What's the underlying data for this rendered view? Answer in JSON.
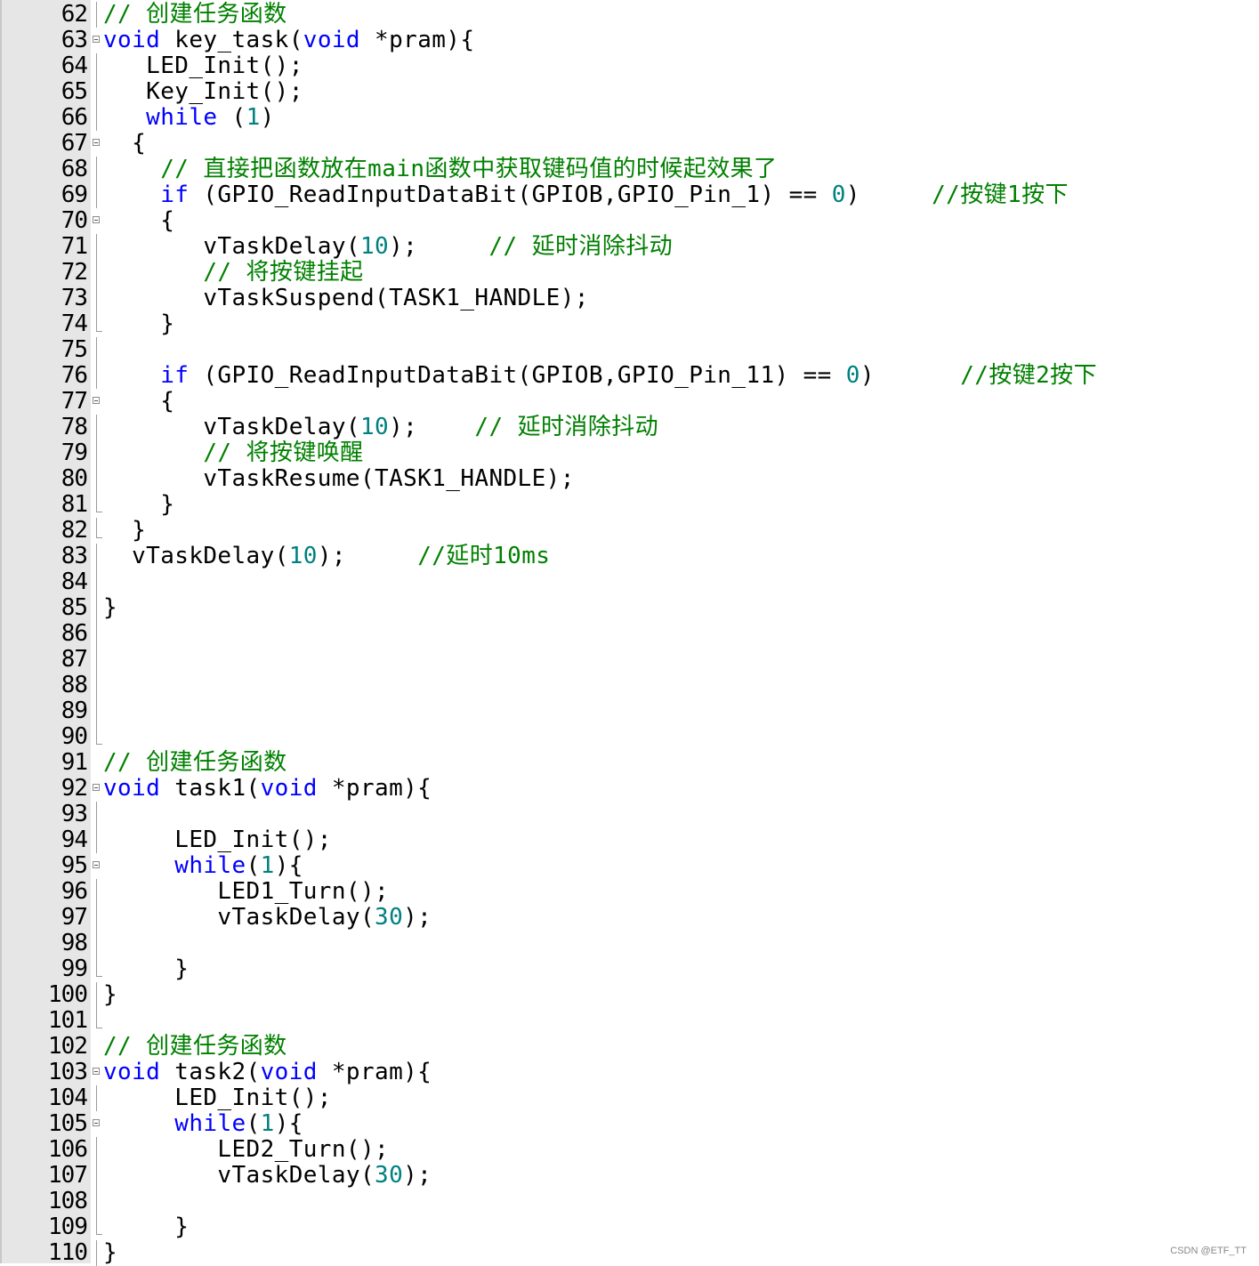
{
  "editor": {
    "lines": [
      {
        "num": "62",
        "fold": "line",
        "tokens": [
          {
            "t": "// 创建任务函数",
            "k": "comment"
          }
        ]
      },
      {
        "num": "63",
        "fold": "box",
        "tokens": [
          {
            "t": "void",
            "k": "keyword"
          },
          {
            "t": " key_task(",
            "k": "plain"
          },
          {
            "t": "void",
            "k": "keyword"
          },
          {
            "t": " *pram){",
            "k": "plain"
          }
        ]
      },
      {
        "num": "64",
        "fold": "line",
        "tokens": [
          {
            "t": "   LED_Init();",
            "k": "plain"
          }
        ]
      },
      {
        "num": "65",
        "fold": "line",
        "tokens": [
          {
            "t": "   Key_Init();",
            "k": "plain"
          }
        ]
      },
      {
        "num": "66",
        "fold": "line",
        "tokens": [
          {
            "t": "   ",
            "k": "plain"
          },
          {
            "t": "while",
            "k": "keyword"
          },
          {
            "t": " (",
            "k": "plain"
          },
          {
            "t": "1",
            "k": "number"
          },
          {
            "t": ")",
            "k": "plain"
          }
        ]
      },
      {
        "num": "67",
        "fold": "box",
        "tokens": [
          {
            "t": "  {",
            "k": "plain"
          }
        ]
      },
      {
        "num": "68",
        "fold": "line",
        "tokens": [
          {
            "t": "    ",
            "k": "plain"
          },
          {
            "t": "// 直接把函数放在main函数中获取键码值的时候起效果了",
            "k": "comment"
          }
        ]
      },
      {
        "num": "69",
        "fold": "line",
        "tokens": [
          {
            "t": "    ",
            "k": "plain"
          },
          {
            "t": "if",
            "k": "keyword"
          },
          {
            "t": " (GPIO_ReadInputDataBit(GPIOB,GPIO_Pin_1) == ",
            "k": "plain"
          },
          {
            "t": "0",
            "k": "number"
          },
          {
            "t": ")     ",
            "k": "plain"
          },
          {
            "t": "//按键1按下",
            "k": "comment"
          }
        ]
      },
      {
        "num": "70",
        "fold": "box",
        "tokens": [
          {
            "t": "    {",
            "k": "plain"
          }
        ]
      },
      {
        "num": "71",
        "fold": "line",
        "tokens": [
          {
            "t": "       vTaskDelay(",
            "k": "plain"
          },
          {
            "t": "10",
            "k": "number"
          },
          {
            "t": ");     ",
            "k": "plain"
          },
          {
            "t": "// 延时消除抖动",
            "k": "comment"
          }
        ]
      },
      {
        "num": "72",
        "fold": "line",
        "tokens": [
          {
            "t": "       ",
            "k": "plain"
          },
          {
            "t": "// 将按键挂起",
            "k": "comment"
          }
        ]
      },
      {
        "num": "73",
        "fold": "line",
        "tokens": [
          {
            "t": "       vTaskSuspend(TASK1_HANDLE);",
            "k": "plain"
          }
        ]
      },
      {
        "num": "74",
        "fold": "end",
        "tokens": [
          {
            "t": "    }",
            "k": "plain"
          }
        ]
      },
      {
        "num": "75",
        "fold": "line",
        "tokens": []
      },
      {
        "num": "76",
        "fold": "line",
        "tokens": [
          {
            "t": "    ",
            "k": "plain"
          },
          {
            "t": "if",
            "k": "keyword"
          },
          {
            "t": " (GPIO_ReadInputDataBit(GPIOB,GPIO_Pin_11) == ",
            "k": "plain"
          },
          {
            "t": "0",
            "k": "number"
          },
          {
            "t": ")      ",
            "k": "plain"
          },
          {
            "t": "//按键2按下",
            "k": "comment"
          }
        ]
      },
      {
        "num": "77",
        "fold": "box",
        "tokens": [
          {
            "t": "    {",
            "k": "plain"
          }
        ]
      },
      {
        "num": "78",
        "fold": "line",
        "tokens": [
          {
            "t": "       vTaskDelay(",
            "k": "plain"
          },
          {
            "t": "10",
            "k": "number"
          },
          {
            "t": ");    ",
            "k": "plain"
          },
          {
            "t": "// 延时消除抖动",
            "k": "comment"
          }
        ]
      },
      {
        "num": "79",
        "fold": "line",
        "tokens": [
          {
            "t": "       ",
            "k": "plain"
          },
          {
            "t": "// 将按键唤醒",
            "k": "comment"
          }
        ]
      },
      {
        "num": "80",
        "fold": "line",
        "tokens": [
          {
            "t": "       vTaskResume(TASK1_HANDLE);",
            "k": "plain"
          }
        ]
      },
      {
        "num": "81",
        "fold": "end",
        "tokens": [
          {
            "t": "    }",
            "k": "plain"
          }
        ]
      },
      {
        "num": "82",
        "fold": "end",
        "tokens": [
          {
            "t": "  }",
            "k": "plain"
          }
        ]
      },
      {
        "num": "83",
        "fold": "line",
        "tokens": [
          {
            "t": "  vTaskDelay(",
            "k": "plain"
          },
          {
            "t": "10",
            "k": "number"
          },
          {
            "t": ");     ",
            "k": "plain"
          },
          {
            "t": "//延时10ms",
            "k": "comment"
          }
        ]
      },
      {
        "num": "84",
        "fold": "line",
        "tokens": []
      },
      {
        "num": "85",
        "fold": "line",
        "tokens": [
          {
            "t": "}",
            "k": "plain"
          }
        ]
      },
      {
        "num": "86",
        "fold": "line",
        "tokens": []
      },
      {
        "num": "87",
        "fold": "line",
        "tokens": []
      },
      {
        "num": "88",
        "fold": "line",
        "tokens": []
      },
      {
        "num": "89",
        "fold": "line",
        "tokens": []
      },
      {
        "num": "90",
        "fold": "end",
        "tokens": []
      },
      {
        "num": "91",
        "fold": "none",
        "tokens": [
          {
            "t": "// 创建任务函数",
            "k": "comment"
          }
        ]
      },
      {
        "num": "92",
        "fold": "box",
        "tokens": [
          {
            "t": "void",
            "k": "keyword"
          },
          {
            "t": " task1(",
            "k": "plain"
          },
          {
            "t": "void",
            "k": "keyword"
          },
          {
            "t": " *pram){",
            "k": "plain"
          }
        ]
      },
      {
        "num": "93",
        "fold": "line",
        "tokens": []
      },
      {
        "num": "94",
        "fold": "line",
        "tokens": [
          {
            "t": "     LED_Init();",
            "k": "plain"
          }
        ]
      },
      {
        "num": "95",
        "fold": "box",
        "tokens": [
          {
            "t": "     ",
            "k": "plain"
          },
          {
            "t": "while",
            "k": "keyword"
          },
          {
            "t": "(",
            "k": "plain"
          },
          {
            "t": "1",
            "k": "number"
          },
          {
            "t": "){",
            "k": "plain"
          }
        ]
      },
      {
        "num": "96",
        "fold": "line",
        "tokens": [
          {
            "t": "        LED1_Turn();",
            "k": "plain"
          }
        ]
      },
      {
        "num": "97",
        "fold": "line",
        "tokens": [
          {
            "t": "        vTaskDelay(",
            "k": "plain"
          },
          {
            "t": "30",
            "k": "number"
          },
          {
            "t": ");",
            "k": "plain"
          }
        ]
      },
      {
        "num": "98",
        "fold": "line",
        "tokens": []
      },
      {
        "num": "99",
        "fold": "end",
        "tokens": [
          {
            "t": "     }",
            "k": "plain"
          }
        ]
      },
      {
        "num": "100",
        "fold": "line",
        "tokens": [
          {
            "t": "}",
            "k": "plain"
          }
        ]
      },
      {
        "num": "101",
        "fold": "end",
        "tokens": []
      },
      {
        "num": "102",
        "fold": "none",
        "tokens": [
          {
            "t": "// 创建任务函数",
            "k": "comment"
          }
        ]
      },
      {
        "num": "103",
        "fold": "box",
        "tokens": [
          {
            "t": "void",
            "k": "keyword"
          },
          {
            "t": " task2(",
            "k": "plain"
          },
          {
            "t": "void",
            "k": "keyword"
          },
          {
            "t": " *pram){",
            "k": "plain"
          }
        ]
      },
      {
        "num": "104",
        "fold": "line",
        "tokens": [
          {
            "t": "     LED_Init();",
            "k": "plain"
          }
        ]
      },
      {
        "num": "105",
        "fold": "box",
        "tokens": [
          {
            "t": "     ",
            "k": "plain"
          },
          {
            "t": "while",
            "k": "keyword"
          },
          {
            "t": "(",
            "k": "plain"
          },
          {
            "t": "1",
            "k": "number"
          },
          {
            "t": "){",
            "k": "plain"
          }
        ]
      },
      {
        "num": "106",
        "fold": "line",
        "tokens": [
          {
            "t": "        LED2_Turn();",
            "k": "plain"
          }
        ]
      },
      {
        "num": "107",
        "fold": "line",
        "tokens": [
          {
            "t": "        vTaskDelay(",
            "k": "plain"
          },
          {
            "t": "30",
            "k": "number"
          },
          {
            "t": ");",
            "k": "plain"
          }
        ]
      },
      {
        "num": "108",
        "fold": "line",
        "tokens": []
      },
      {
        "num": "109",
        "fold": "end",
        "tokens": [
          {
            "t": "     }",
            "k": "plain"
          }
        ]
      },
      {
        "num": "110",
        "fold": "line",
        "tokens": [
          {
            "t": "}",
            "k": "plain"
          }
        ]
      }
    ]
  },
  "watermark": "CSDN @ETF_TT",
  "colors": {
    "keyword": "#0000ff",
    "number": "#008080",
    "comment": "#008000",
    "plain": "#000000",
    "gutter": "#e6e6e6"
  }
}
